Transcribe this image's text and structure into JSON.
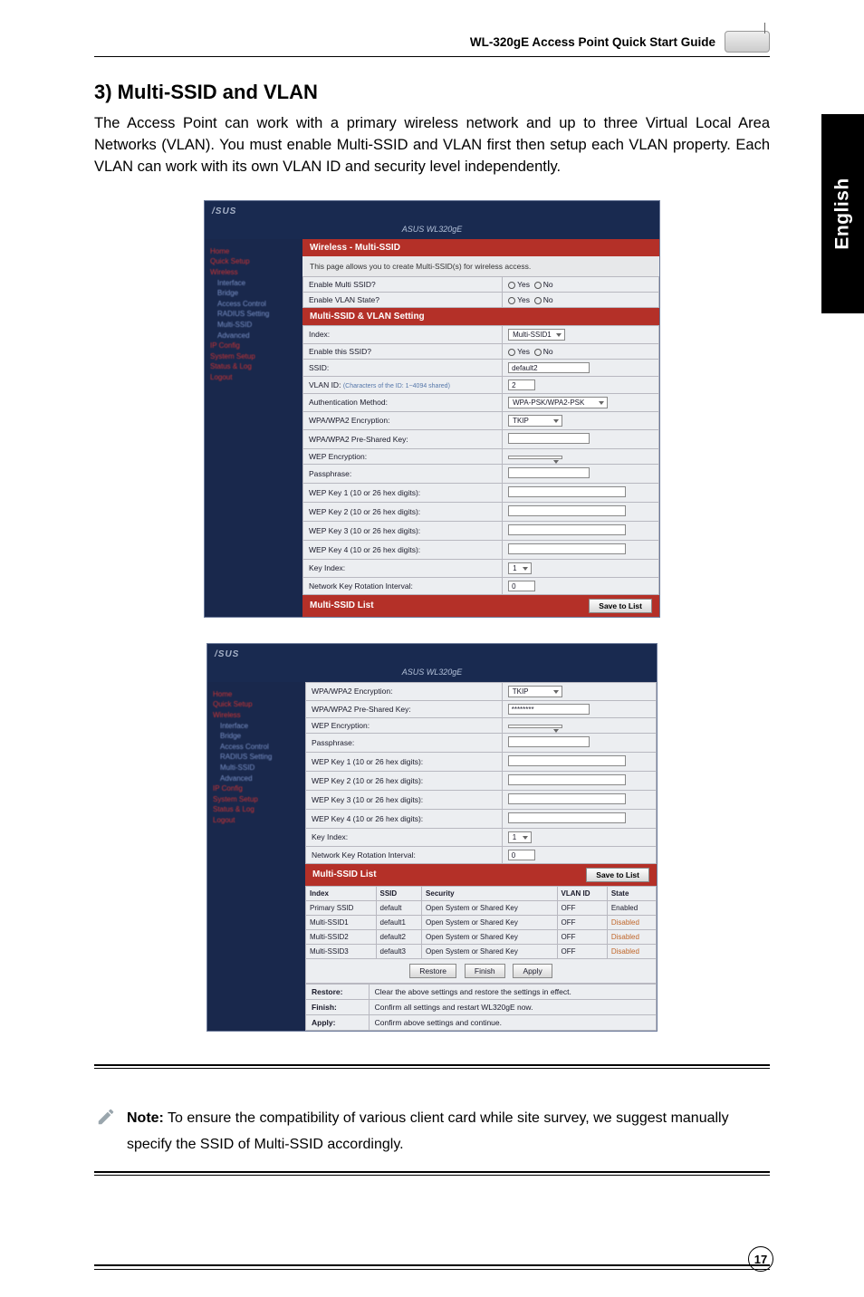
{
  "header": {
    "doc_title": "WL-320gE Access Point Quick Start Guide"
  },
  "side_tab": "English",
  "section": {
    "title": "3) Multi-SSID and VLAN",
    "intro": "The Access Point can work with a primary wireless network and up to three Virtual Local Area Networks (VLAN). You must enable Multi-SSID and VLAN first then setup each VLAN property. Each VLAN can work with its own VLAN ID and security level independently."
  },
  "shot1": {
    "brand": "/SUS",
    "model": "ASUS WL320gE",
    "nav": [
      "Home",
      "Quick Setup",
      "Wireless",
      "Interface",
      "Bridge",
      "Access Control",
      "RADIUS Setting",
      "Multi-SSID",
      "Advanced",
      "IP Config",
      "System Setup",
      "Status & Log",
      "Logout"
    ],
    "band1": "Wireless - Multi-SSID",
    "desc": "This page allows you to create Multi-SSID(s) for wireless access.",
    "rows": [
      {
        "label": "Enable Multi SSID?",
        "val_a": "Yes",
        "val_b": "No"
      },
      {
        "label": "Enable VLAN State?",
        "val_a": "Yes",
        "val_b": "No"
      }
    ],
    "band2": "Multi-SSID & VLAN Setting",
    "rows2": [
      {
        "label": "Index:",
        "sel": "Multi-SSID1"
      },
      {
        "label": "Enable this SSID?",
        "val_a": "Yes",
        "val_b": "No"
      },
      {
        "label": "SSID:",
        "txt": "default2"
      },
      {
        "label": "VLAN ID:",
        "txt": "2",
        "extra": "(Characters of the ID: 1~4094 shared)"
      },
      {
        "label": "Authentication Method:",
        "sel": "WPA-PSK/WPA2-PSK"
      },
      {
        "label": "WPA/WPA2 Encryption:",
        "sel": "TKIP"
      },
      {
        "label": "WPA/WPA2 Pre-Shared Key:",
        "txt": ""
      },
      {
        "label": "WEP Encryption:",
        "sel": ""
      },
      {
        "label": "Passphrase:",
        "txt": ""
      },
      {
        "label": "WEP Key 1 (10 or 26 hex digits):",
        "txt": ""
      },
      {
        "label": "WEP Key 2 (10 or 26 hex digits):",
        "txt": ""
      },
      {
        "label": "WEP Key 3 (10 or 26 hex digits):",
        "txt": ""
      },
      {
        "label": "WEP Key 4 (10 or 26 hex digits):",
        "txt": ""
      },
      {
        "label": "Key Index:",
        "sel": "1"
      },
      {
        "label": "Network Key Rotation Interval:",
        "txt": "0"
      }
    ],
    "band3": "Multi-SSID List",
    "btn": "Save to List"
  },
  "shot2": {
    "brand": "/SUS",
    "model": "ASUS WL320gE",
    "nav": [
      "Home",
      "Quick Setup",
      "Wireless",
      "Interface",
      "Bridge",
      "Access Control",
      "RADIUS Setting",
      "Multi-SSID",
      "Advanced",
      "IP Config",
      "System Setup",
      "Status & Log",
      "Logout"
    ],
    "rows": [
      {
        "label": "WPA/WPA2 Encryption:",
        "sel": "TKIP"
      },
      {
        "label": "WPA/WPA2 Pre-Shared Key:",
        "txt": "********"
      },
      {
        "label": "WEP Encryption:",
        "sel": ""
      },
      {
        "label": "Passphrase:",
        "txt": ""
      },
      {
        "label": "WEP Key 1 (10 or 26 hex digits):",
        "txt": ""
      },
      {
        "label": "WEP Key 2 (10 or 26 hex digits):",
        "txt": ""
      },
      {
        "label": "WEP Key 3 (10 or 26 hex digits):",
        "txt": ""
      },
      {
        "label": "WEP Key 4 (10 or 26 hex digits):",
        "txt": ""
      },
      {
        "label": "Key Index:",
        "sel": "1"
      },
      {
        "label": "Network Key Rotation Interval:",
        "txt": "0"
      }
    ],
    "list_title": "Multi-SSID List",
    "list_btn": "Save to List",
    "cols": [
      "Index",
      "SSID",
      "Security",
      "VLAN ID",
      "State"
    ],
    "data": [
      {
        "idx": "Primary SSID",
        "ssid": "default",
        "sec": "Open System or Shared Key",
        "vlan": "OFF",
        "state": "Enabled"
      },
      {
        "idx": "Multi-SSID1",
        "ssid": "default1",
        "sec": "Open System or Shared Key",
        "vlan": "OFF",
        "state": "Disabled"
      },
      {
        "idx": "Multi-SSID2",
        "ssid": "default2",
        "sec": "Open System or Shared Key",
        "vlan": "OFF",
        "state": "Disabled"
      },
      {
        "idx": "Multi-SSID3",
        "ssid": "default3",
        "sec": "Open System or Shared Key",
        "vlan": "OFF",
        "state": "Disabled"
      }
    ],
    "actions_btns": [
      "Restore",
      "Finish",
      "Apply"
    ],
    "actions": [
      {
        "label": "Restore:",
        "text": "Clear the above settings and restore the settings in effect."
      },
      {
        "label": "Finish:",
        "text": "Confirm all settings and restart WL320gE now."
      },
      {
        "label": "Apply:",
        "text": "Confirm above settings and continue."
      }
    ]
  },
  "note": {
    "bold": "Note:",
    "text": " To ensure the compatibility of various client card while site survey, we suggest manually specify the SSID of Multi-SSID accordingly."
  },
  "page_number": "17"
}
